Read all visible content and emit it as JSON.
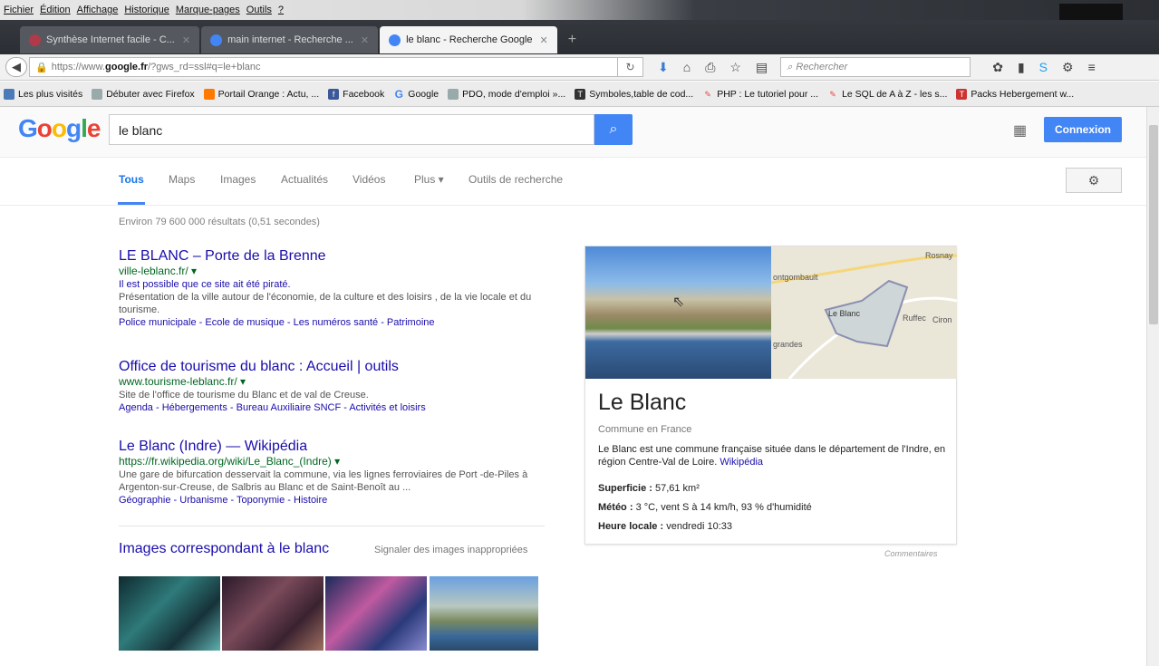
{
  "menu": [
    "Fichier",
    "Édition",
    "Affichage",
    "Historique",
    "Marque-pages",
    "Outils",
    "?"
  ],
  "tabs": [
    {
      "label": "Synthèse Internet facile - C...",
      "icon": "circle-icon",
      "color": "#b03a4a"
    },
    {
      "label": "main internet - Recherche ...",
      "icon": "google-icon",
      "color": "#4285f4"
    },
    {
      "label": "le blanc - Recherche Google",
      "icon": "google-icon",
      "color": "#4285f4"
    }
  ],
  "url": {
    "prefix": "https://www.",
    "domain": "google.fr",
    "path": "/?gws_rd=ssl#q=le+blanc"
  },
  "browser_search_placeholder": "Rechercher",
  "bookmarks": [
    "Les plus visités",
    "Débuter avec Firefox",
    "Portail Orange : Actu, ...",
    "Facebook",
    "Google",
    "PDO, mode d'emploi »...",
    "Symboles,table de cod...",
    "PHP : Le tutoriel pour ...",
    "Le SQL de A à Z - les s...",
    "Packs Hebergement w..."
  ],
  "google": {
    "logo": "Google",
    "query": "le blanc",
    "signin": "Connexion",
    "tabs": [
      "Tous",
      "Maps",
      "Images",
      "Actualités",
      "Vidéos",
      "Plus ▾",
      "Outils de recherche"
    ],
    "stats": "Environ 79 600 000 résultats (0,51 secondes)"
  },
  "results": [
    {
      "title": "LE BLANC – Porte de la Brenne",
      "url": "ville-leblanc.fr/ ▾",
      "warning": "Il est possible que ce site ait été piraté.",
      "snippet": "Présentation de la ville autour de l'économie, de la culture et des loisirs , de la vie locale et du tourisme.",
      "links": "Police municipale - Ecole de musique - Les numéros santé - Patrimoine"
    },
    {
      "title": "Office de tourisme du blanc : Accueil | outils",
      "url": "www.tourisme-leblanc.fr/ ▾",
      "snippet": "Site de l'office de tourisme du Blanc et de val de Creuse.",
      "links": "Agenda - Hébergements - Bureau Auxiliaire SNCF - Activités et loisirs"
    },
    {
      "title": "Le Blanc (Indre) — Wikipédia",
      "url": "https://fr.wikipedia.org/wiki/Le_Blanc_(Indre) ▾",
      "snippet": "Une gare de bifurcation desservait la commune, via les lignes ferroviaires de Port -de-Piles à Argenton-sur-Creuse, de Salbris au Blanc et de Saint-Benoît au ...",
      "links": "Géographie - Urbanisme - Toponymie - Histoire"
    }
  ],
  "images_section": {
    "title": "Images correspondant à le blanc",
    "report": "Signaler des images inappropriées"
  },
  "knowledge": {
    "title": "Le Blanc",
    "subtitle": "Commune en France",
    "description": "Le Blanc est une commune française située dans le département de l'Indre, en région Centre-Val de Loire.",
    "source": "Wikipédia",
    "facts": [
      {
        "label": "Superficie :",
        "value": "57,61 km²"
      },
      {
        "label": "Météo :",
        "value": "3 °C, vent S à 14 km/h, 93 % d'humidité"
      },
      {
        "label": "Heure locale :",
        "value": "vendredi 10:33"
      }
    ],
    "map_labels": [
      "Rosnay",
      "ontgombault",
      "Le Blanc",
      "Ruffec",
      "Ciron",
      "grandes"
    ],
    "feedback": "Commentaires"
  }
}
